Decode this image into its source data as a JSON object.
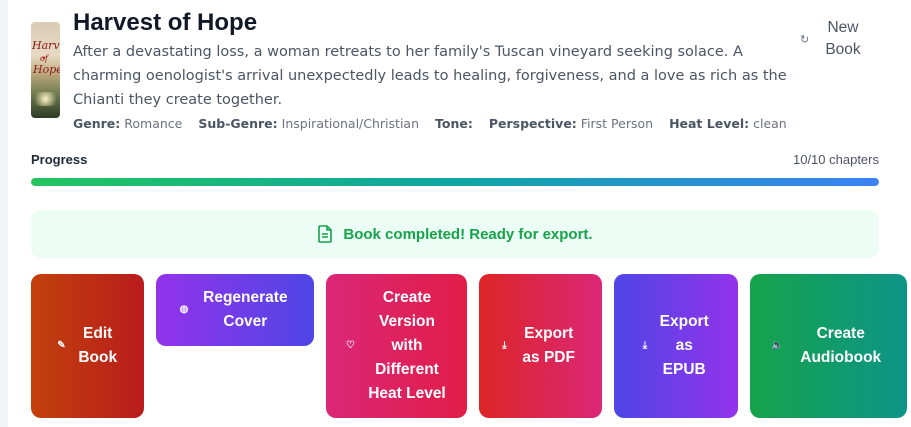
{
  "book": {
    "title": "Harvest of Hope",
    "cover_title": [
      "Harvest",
      "of",
      "Hope"
    ],
    "description": "After a devastating loss, a woman retreats to her family's Tuscan vineyard seeking solace. A charming oenologist's arrival unexpectedly leads to healing, forgiveness, and a love as rich as the Chianti they create together.",
    "meta": [
      {
        "label": "Genre:",
        "value": "Romance"
      },
      {
        "label": "Sub-Genre:",
        "value": "Inspirational/Christian"
      },
      {
        "label": "Tone:",
        "value": ""
      },
      {
        "label": "Perspective:",
        "value": "First Person"
      },
      {
        "label": "Heat Level:",
        "value": "clean"
      }
    ]
  },
  "header": {
    "new_book_label": "New Book",
    "new_book_icon": "refresh-icon"
  },
  "progress": {
    "label": "Progress",
    "count_text": "10/10 chapters",
    "completed": 10,
    "total": 10
  },
  "status": {
    "message": "Book completed! Ready for export.",
    "icon": "document-icon",
    "color": "#16a34a"
  },
  "actions": [
    {
      "label": "Edit Book",
      "icon": "pencil-icon"
    },
    {
      "label": "Regenerate Cover",
      "icon": "palette-icon"
    },
    {
      "label": "Create Version with Different Heat Level",
      "icon": "heart-icon"
    },
    {
      "label": "Export as PDF",
      "icon": "download-icon"
    },
    {
      "label": "Export as EPUB",
      "icon": "download-icon"
    },
    {
      "label": "Create Audiobook",
      "icon": "speaker-icon"
    }
  ],
  "colors": {
    "progress_start": "#22c55e",
    "progress_end": "#3b82f6",
    "banner_bg": "#ecfdf5"
  }
}
